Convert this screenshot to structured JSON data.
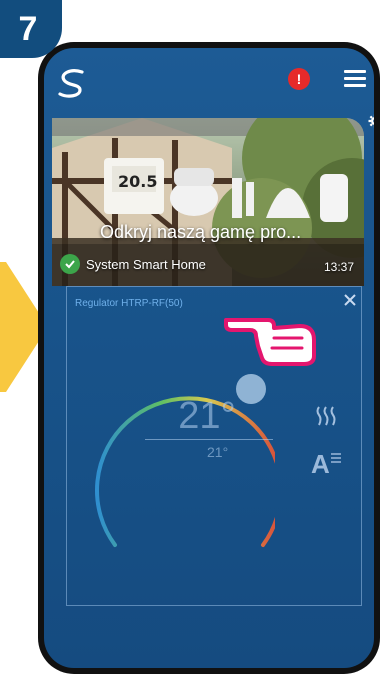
{
  "step_number": "7",
  "colors": {
    "step_badge": "#124d7e",
    "screen_bg": "#1a5690",
    "alert": "#e62a2a",
    "banner_check": "#3ca54a",
    "pointer_arrow": "#f8c840",
    "hand_accent": "#e4166e"
  },
  "header": {
    "logo_icon": "salus-logo-icon",
    "notification_count": "!",
    "menu_icon": "hamburger-menu-icon"
  },
  "banner": {
    "title": "Odkryj naszą gamę pro...",
    "subtitle": "System Smart Home",
    "time": "13:37",
    "device_display_reading": "20.5"
  },
  "device_card": {
    "title": "Regulator HTRP-RF(50)",
    "current_temperature": "21°",
    "set_temperature": "21°",
    "mode_label": "A",
    "heating_icon": "heat-waves-icon",
    "close_icon": "close-icon"
  }
}
